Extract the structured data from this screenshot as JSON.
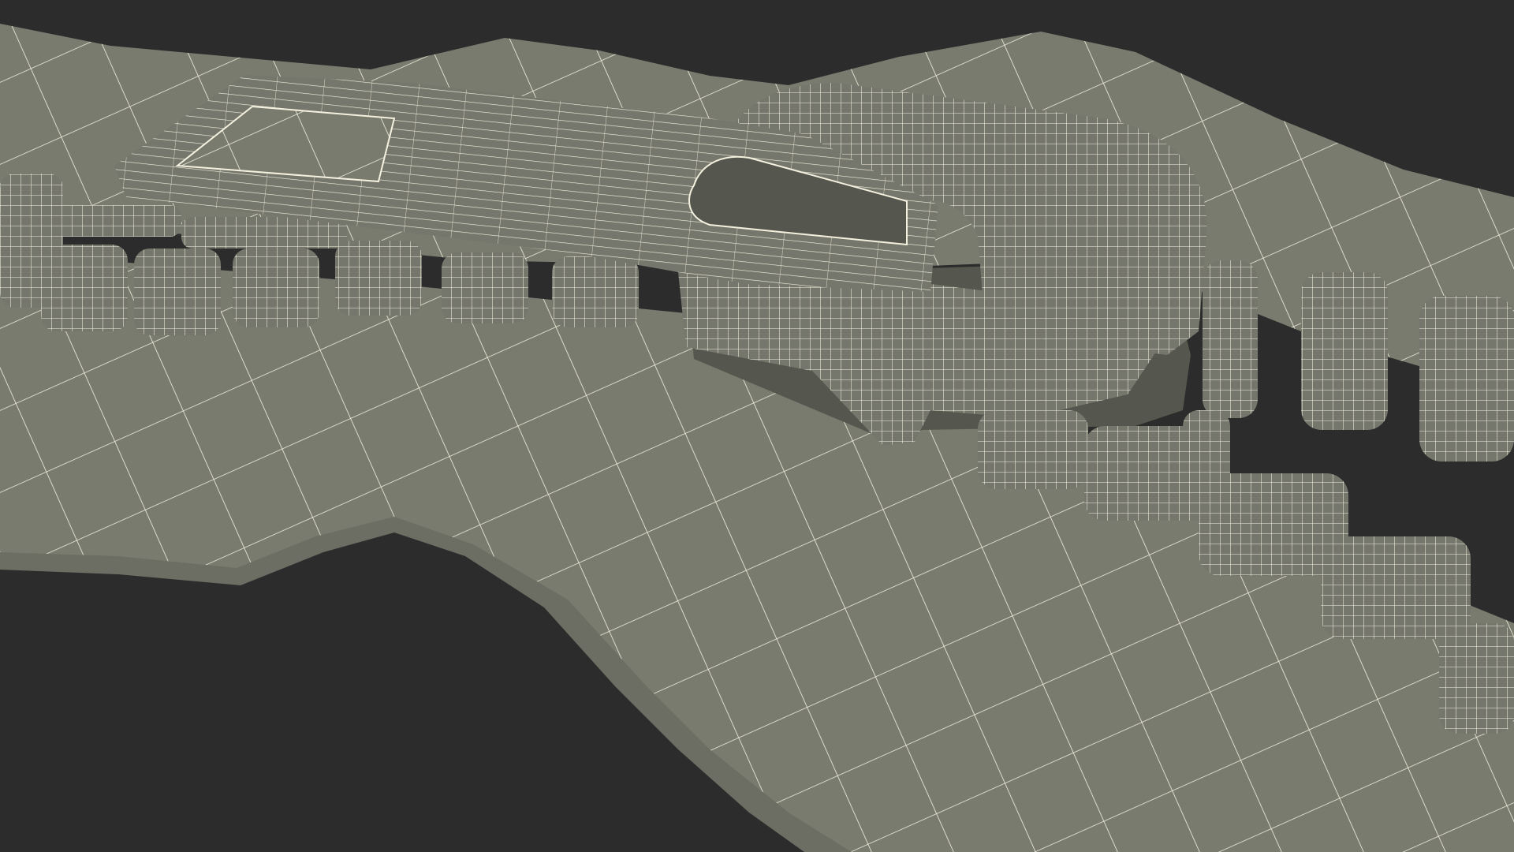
{
  "scene": {
    "subject": "zipper-wireframe-render",
    "background_color": "#2c2c2c",
    "fabric_color": "#7a7b6f",
    "fabric_shade_color": "#6d6e63",
    "metal_color": "#76776c",
    "metal_shadow_color": "#55564d",
    "wire_color": "#f4f1df",
    "left_teeth_interlocked_count": 9,
    "right_upper_teeth_count": 4,
    "right_lower_teeth_count": 5
  }
}
